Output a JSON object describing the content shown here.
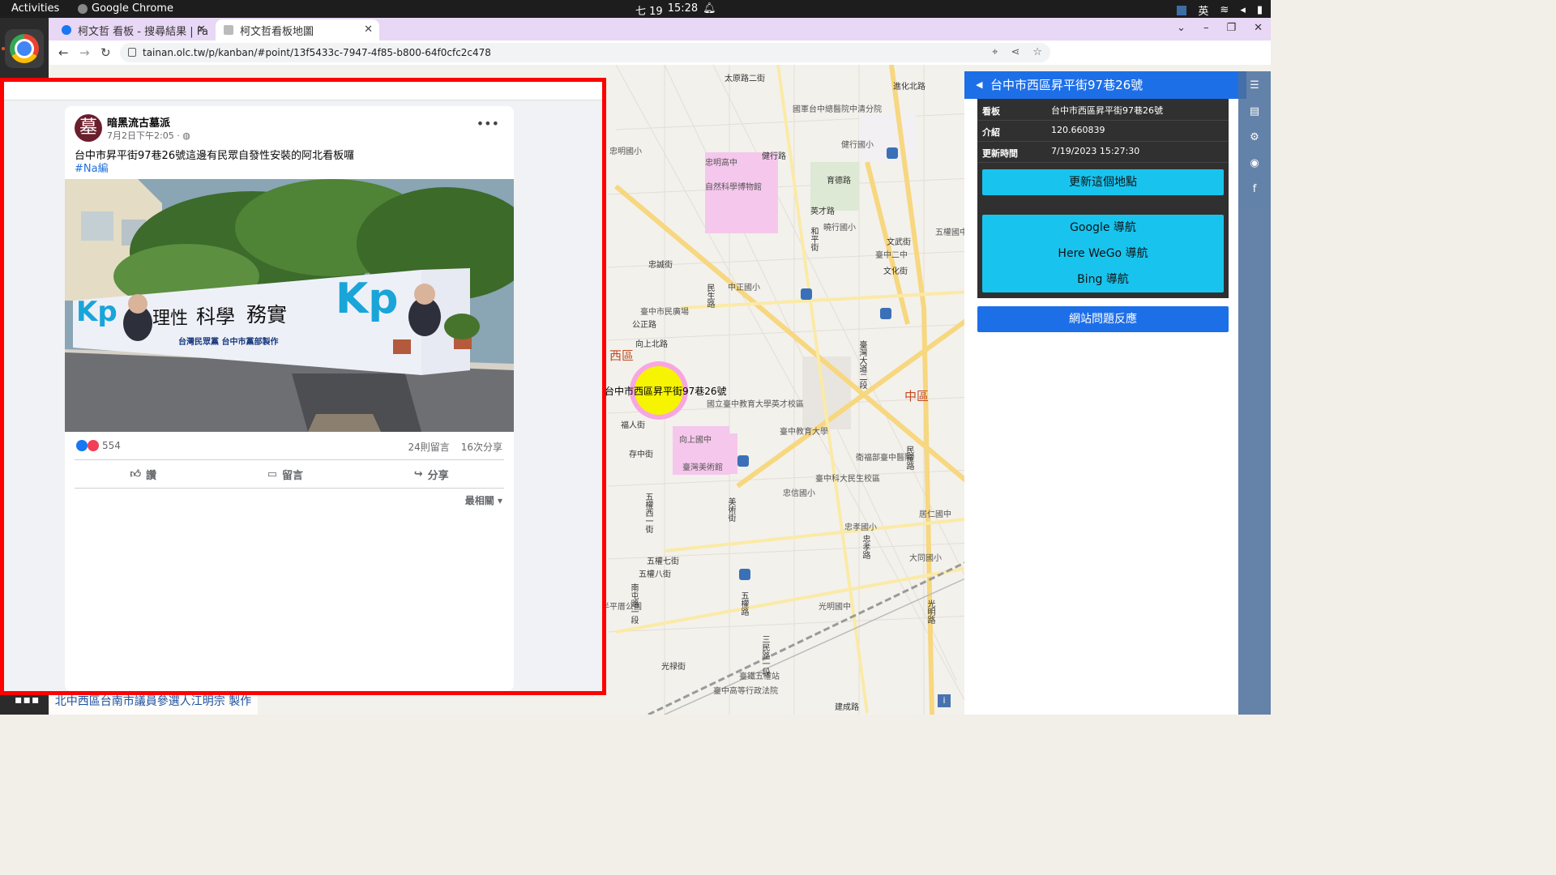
{
  "system": {
    "activities": "Activities",
    "app_name": "Google Chrome",
    "date": "七 19",
    "time": "15:28",
    "ime_lang": "英"
  },
  "browser": {
    "tabs": [
      {
        "label": "柯文哲 看板 - 搜尋結果 | Fa"
      },
      {
        "label": "柯文哲看板地圖"
      }
    ],
    "url": "tainan.olc.tw/p/kanban/#point/13f5433c-7947-4f85-b800-64f0cfc2c478"
  },
  "post": {
    "avatar_char": "墓",
    "author": "暗黑流古墓派",
    "time": "7月2日下午2:05 · ",
    "message": "台中市昇平街97巷26號這邊有民眾自發性安裝的阿北看板囉",
    "hashtag": "#Na編",
    "banner": {
      "logo_text": "Kp",
      "slogan_1": "理性",
      "slogan_2": "科學",
      "slogan_3": "務實",
      "credit": "台灣民眾黨 台中市黨部製作"
    },
    "reaction_count": "554",
    "comments": "24則留言",
    "shares": "16次分享",
    "actions": {
      "like": "讚",
      "comment": "留言",
      "share": "分享"
    },
    "sort_label": "最相關"
  },
  "panel": {
    "title": "台中市西區昇平街97巷26號",
    "rows": [
      {
        "key": "看板",
        "value": "台中市西區昇平街97巷26號"
      },
      {
        "key": "介紹",
        "value": "120.660839"
      },
      {
        "key": "更新時間",
        "value": "7/19/2023 15:27:30"
      }
    ],
    "update_button": "更新這個地點",
    "nav": {
      "google": "Google 導航",
      "here": "Here WeGo 導航",
      "bing": "Bing 導航"
    },
    "feedback_button": "網站問題反應"
  },
  "map": {
    "marker_label": "台中市西區昇平街97巷26號",
    "attribution": "北中西區台南市議員參選人江明宗 製作",
    "districts": {
      "west": "西區",
      "central": "中區"
    },
    "streets": {
      "taiping_tw": "太原路二街",
      "jinhua": "進化北路",
      "minsheng": "民生路",
      "jiantxing": "健行路",
      "yingcai": "英才路",
      "yuren": "育德路",
      "xiangshang": "向上北路",
      "gongzheng": "公正路",
      "wuquan": "五權路",
      "meichuan": "美術街",
      "wuquan_1": "五權西一街",
      "wuquan_7": "五權七街",
      "wuquan_8": "五權八街",
      "guangming": "光明路",
      "wenzhuan": "文武街",
      "wenhua": "文化街",
      "zhongxing": "忠誠街",
      "zhongxiao": "忠孝路",
      "jiancheng": "建成路",
      "minquan": "民權路",
      "taiwan_blvd": "臺灣大道二段",
      "heping": "和平街",
      "cunzhong": "存中街",
      "fuyang": "福人街",
      "nanqu": "南屯路一段",
      "guangcai": "光禄街"
    },
    "pois": {
      "hospital": "國軍台中總醫院中清分院",
      "zhongming": "忠明國小",
      "zhongming_hs": "忠明高中",
      "museum": "自然科學博物館",
      "jianxing_es": "健行國小",
      "kaotsun_es": "曉行國小",
      "taichung2": "臺中二中",
      "wuquan_es": "五權國中",
      "zhongzheng": "中正國小",
      "minsheng_park": "臺中市民廣場",
      "uni_ed": "國立臺中教育大學英才校區",
      "taichung_ed": "臺中教育大學",
      "xiangshang_jh": "向上國中",
      "art_museum": "臺灣美術館",
      "health": "衛福部臺中醫院",
      "minsheng_campus": "臺中科大民生校區",
      "zhongxin_es": "忠信國小",
      "zhongxiao_es": "忠孝國小",
      "juren_jh": "居仁國中",
      "datong_es": "大同國小",
      "guangming_jh": "光明國中",
      "wuquan_gs": "臺鐵五權站",
      "court": "臺中高等行政法院",
      "park1": "半平厝公園",
      "sanmin": "三民路一段"
    }
  },
  "colors": {
    "frame_red": "#ff0000",
    "panel_blue": "#1d6fe8",
    "nav_cyan": "#18c4ee",
    "marker_yellow": "#f6f400",
    "marker_ring": "#f7a6e2"
  }
}
